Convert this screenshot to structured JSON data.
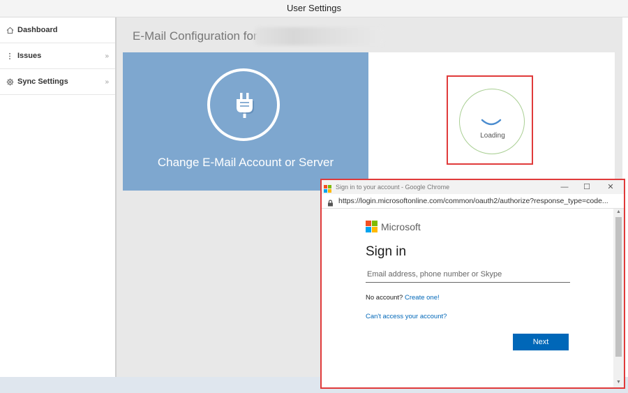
{
  "window": {
    "title": "User Settings"
  },
  "sidebar": {
    "items": [
      {
        "label": "Dashboard",
        "icon": "home-icon"
      },
      {
        "label": "Issues",
        "icon": "dots-vertical-icon",
        "chevron": "»"
      },
      {
        "label": "Sync Settings",
        "icon": "gear-icon",
        "chevron": "»"
      }
    ]
  },
  "main": {
    "title": "E-Mail Configuration for",
    "change_card_label": "Change E-Mail Account or Server",
    "loading_text": "Loading"
  },
  "popup": {
    "window_title": "Sign in to your account - Google Chrome",
    "url": "https://login.microsoftonline.com/common/oauth2/authorize?response_type=code...",
    "brand": "Microsoft",
    "heading": "Sign in",
    "email_placeholder": "Email address, phone number or Skype",
    "no_account_text": "No account?",
    "create_link": "Create one!",
    "cant_access_link": "Can't access your account?",
    "next_button": "Next"
  },
  "colors": {
    "accent_blue": "#7ea7cf",
    "ms_blue": "#0067b8",
    "highlight_red": "#e03a3a",
    "loading_green": "#a9cf93"
  }
}
